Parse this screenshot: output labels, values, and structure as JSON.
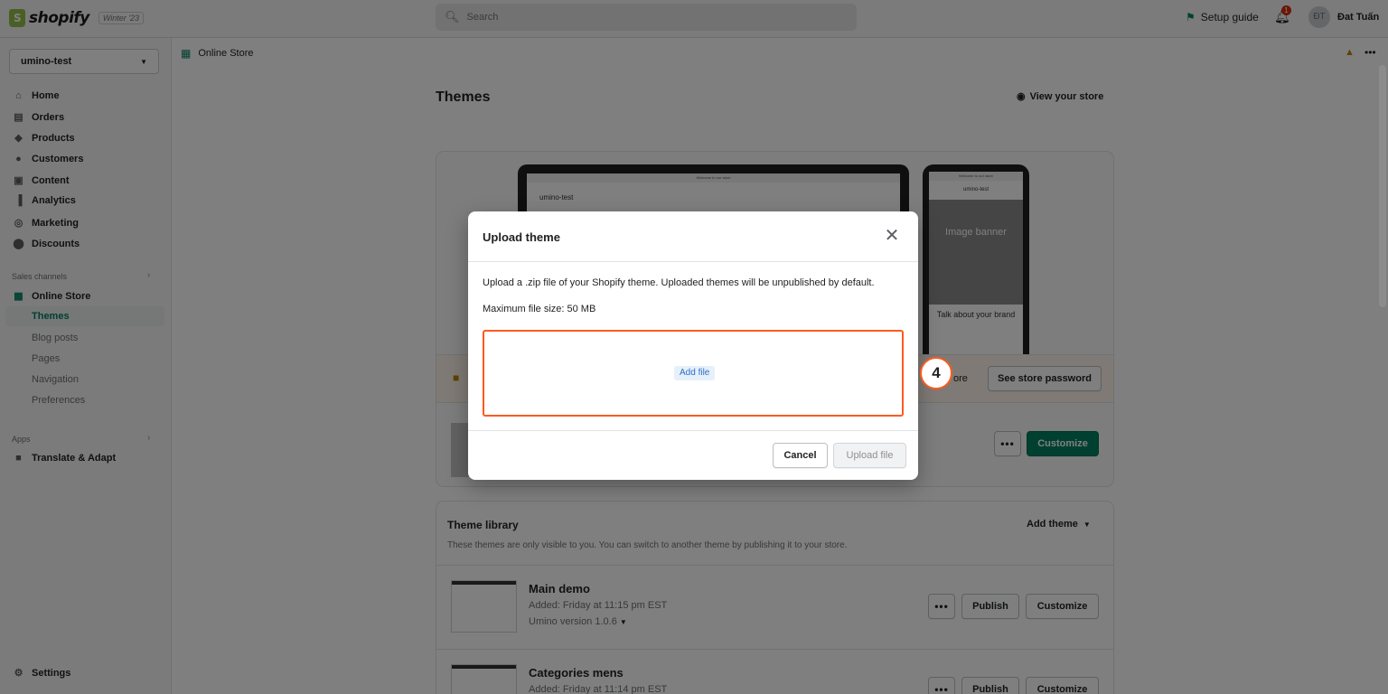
{
  "topbar": {
    "brand": "shopify",
    "edition": "Winter '23",
    "search_placeholder": "Search",
    "setup_guide": "Setup guide",
    "notifications": "1",
    "avatar_initials": "ĐT",
    "username": "Đat Tuấn"
  },
  "sidebar": {
    "store": "umino-test",
    "items": [
      "Home",
      "Orders",
      "Products",
      "Customers",
      "Content",
      "Analytics",
      "Marketing",
      "Discounts"
    ],
    "sales_channels": "Sales channels",
    "online_store": "Online Store",
    "online_store_sub": [
      "Themes",
      "Blog posts",
      "Pages",
      "Navigation",
      "Preferences"
    ],
    "apps": "Apps",
    "app_items": [
      "Translate & Adapt"
    ],
    "settings": "Settings"
  },
  "breadcrumb": {
    "label": "Online Store"
  },
  "main": {
    "title": "Themes",
    "view_store": "View your store",
    "preview": {
      "laptop_bar": "Welcome to our store",
      "laptop_store": "umino-test",
      "phone_bar": "Welcome to our store",
      "phone_store": "umino-test",
      "banner": "Image banner",
      "talk": "Talk about your brand"
    },
    "password_banner_tail": "ore",
    "see_password": "See store password",
    "customize": "Customize",
    "library": {
      "title": "Theme library",
      "description": "These themes are only visible to you. You can switch to another theme by publishing it to your store.",
      "add_theme": "Add theme",
      "themes": [
        {
          "name": "Main demo",
          "added": "Added: Friday at 11:15 pm EST",
          "version": "Umino version 1.0.6"
        },
        {
          "name": "Categories mens",
          "added": "Added: Friday at 11:14 pm EST",
          "version": ""
        }
      ],
      "publish": "Publish",
      "customize": "Customize"
    }
  },
  "modal": {
    "title": "Upload theme",
    "description": "Upload a .zip file of your Shopify theme. Uploaded themes will be unpublished by default.",
    "max_size": "Maximum file size: 50 MB",
    "add_file": "Add file",
    "cancel": "Cancel",
    "upload": "Upload file"
  },
  "annotation": {
    "step": "4"
  },
  "colors": {
    "brand": "#008060",
    "highlight": "#ff5a1f",
    "overlay": "rgba(0,0,0,0.5)"
  },
  "icons": [
    "search-icon",
    "flag-icon",
    "bell-icon",
    "home-icon",
    "orders-icon",
    "tag-icon",
    "person-icon",
    "content-icon",
    "analytics-icon",
    "marketing-icon",
    "discount-icon",
    "store-icon",
    "app-icon",
    "settings-icon",
    "eye-icon",
    "lock-icon",
    "close-icon",
    "pin-icon",
    "more-icon"
  ]
}
